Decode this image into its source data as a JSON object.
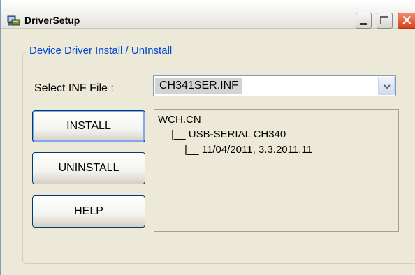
{
  "window": {
    "title": "DriverSetup",
    "app_icon": "driver-setup-icon",
    "controls": {
      "minimize_icon": "minimize-icon",
      "maximize_icon": "maximize-icon",
      "close_icon": "close-icon",
      "close_glyph": "✕"
    }
  },
  "group": {
    "legend": "Device Driver Install / UnInstall"
  },
  "inf": {
    "label": "Select INF File :",
    "selected": "CH341SER.INF",
    "dropdown_icon": "chevron-down-icon"
  },
  "buttons": {
    "install": "INSTALL",
    "uninstall": "UNINSTALL",
    "help": "HELP"
  },
  "info": {
    "line1": "WCH.CN",
    "line2": "|__ USB-SERIAL CH340",
    "line3": "|__ 11/04/2011, 3.3.2011.11"
  },
  "colors": {
    "window_bg": "#ece9d8",
    "legend_text": "#0046d5",
    "close_button": "#d8421b",
    "button_border": "#003c74",
    "focus_ring": "#7ea9f2"
  }
}
